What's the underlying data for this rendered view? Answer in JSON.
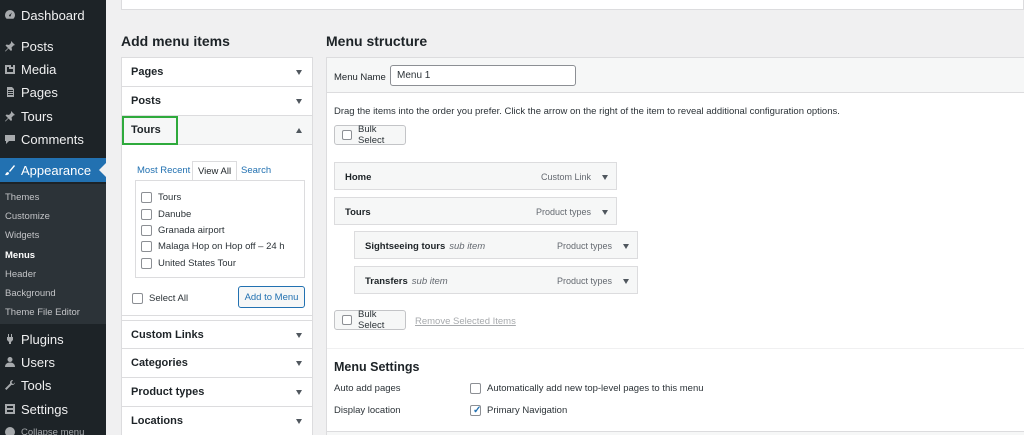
{
  "sidebar": {
    "items": [
      {
        "label": "Dashboard",
        "icon": "dashboard-icon"
      },
      {
        "label": "Posts",
        "icon": "pin-icon"
      },
      {
        "label": "Media",
        "icon": "media-icon"
      },
      {
        "label": "Pages",
        "icon": "page-icon"
      },
      {
        "label": "Tours",
        "icon": "pin-icon"
      },
      {
        "label": "Comments",
        "icon": "comment-icon"
      },
      {
        "label": "Appearance",
        "icon": "brush-icon"
      },
      {
        "label": "Plugins",
        "icon": "plug-icon"
      },
      {
        "label": "Users",
        "icon": "user-icon"
      },
      {
        "label": "Tools",
        "icon": "wrench-icon"
      },
      {
        "label": "Settings",
        "icon": "settings-icon"
      },
      {
        "label": "Collapse menu",
        "icon": "collapse-icon"
      }
    ],
    "submenu": [
      "Themes",
      "Customize",
      "Widgets",
      "Menus",
      "Header",
      "Background",
      "Theme File Editor"
    ]
  },
  "add_menu_items": {
    "heading": "Add menu items",
    "sections": [
      "Pages",
      "Posts",
      "Tours",
      "Custom Links",
      "Categories",
      "Product types",
      "Locations"
    ],
    "tabs": [
      "Most Recent",
      "View All",
      "Search"
    ],
    "items": [
      "Tours",
      "Danube",
      "Granada airport",
      "Malaga Hop on Hop off – 24 h",
      "United States Tour"
    ],
    "select_all": "Select All",
    "add_button": "Add to Menu"
  },
  "menu_structure": {
    "heading": "Menu structure",
    "name_label": "Menu Name",
    "name_value": "Menu 1",
    "instructions": "Drag the items into the order you prefer. Click the arrow on the right of the item to reveal additional configuration options.",
    "bulk_select": "Bulk Select",
    "remove_selected": "Remove Selected Items",
    "items": [
      {
        "title": "Home",
        "sub": "",
        "type": "Custom Link"
      },
      {
        "title": "Tours",
        "sub": "",
        "type": "Product types"
      },
      {
        "title": "Sightseeing tours",
        "sub": "sub item",
        "type": "Product types"
      },
      {
        "title": "Transfers",
        "sub": "sub item",
        "type": "Product types"
      }
    ]
  },
  "menu_settings": {
    "title": "Menu Settings",
    "auto_add_label": "Auto add pages",
    "auto_add_option": "Automatically add new top-level pages to this menu",
    "location_label": "Display location",
    "location_option": "Primary Navigation"
  },
  "colors": {
    "accent": "#2271b1",
    "highlight": "#2eaa3c",
    "sidebar": "#1d2327"
  }
}
